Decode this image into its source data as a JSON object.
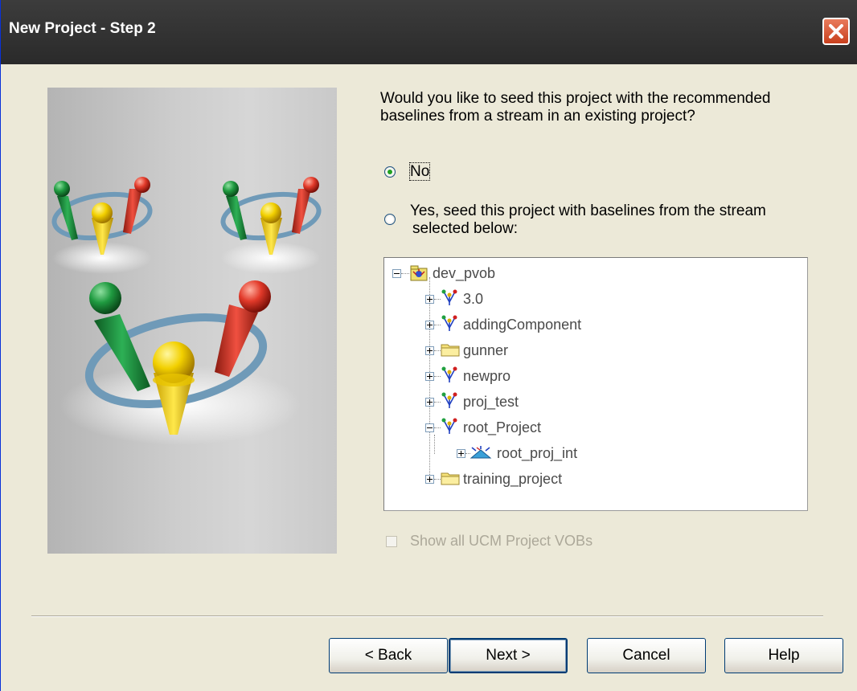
{
  "window": {
    "title": "New Project - Step 2"
  },
  "question": "Would you like to seed this project with the recommended baselines from a stream in an existing project?",
  "options": {
    "no_label": "No",
    "yes_label_line1": "Yes, seed this project with baselines from the stream",
    "yes_label_line2": "selected below:",
    "selected": "No"
  },
  "tree": {
    "root": "dev_pvob",
    "items": [
      {
        "label": "3.0",
        "icon": "project-icon",
        "expanded": false
      },
      {
        "label": "addingComponent",
        "icon": "project-icon",
        "expanded": false
      },
      {
        "label": "gunner",
        "icon": "folder-icon",
        "expanded": false
      },
      {
        "label": "newpro",
        "icon": "project-icon",
        "expanded": false
      },
      {
        "label": "proj_test",
        "icon": "project-icon",
        "expanded": false
      },
      {
        "label": "root_Project",
        "icon": "project-icon",
        "expanded": true
      },
      {
        "label": "training_project",
        "icon": "folder-icon",
        "expanded": false
      }
    ],
    "child": {
      "label": "root_proj_int",
      "icon": "stream-icon",
      "expanded": false
    }
  },
  "checkbox": {
    "label": "Show all UCM Project VOBs",
    "checked": false,
    "enabled": false
  },
  "buttons": {
    "back": "< Back",
    "next": "Next >",
    "cancel": "Cancel",
    "help": "Help"
  },
  "colors": {
    "titlebar": "#333333",
    "dialog_bg": "#ece9d8",
    "close_button": "#d9532c",
    "radio_dot": "#21a121"
  }
}
